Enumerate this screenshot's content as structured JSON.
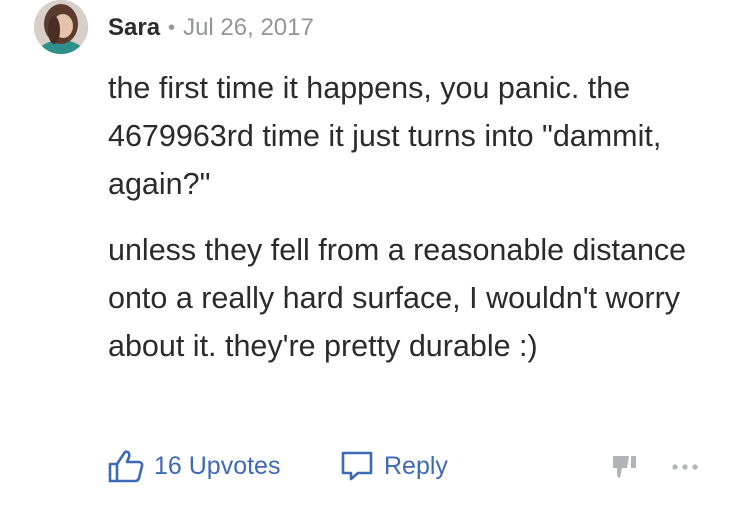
{
  "comment": {
    "author": "Sara",
    "separator": "•",
    "date": "Jul 26, 2017",
    "paragraphs": [
      "the first time it happens, you panic. the 4679963rd time it just turns into \"dammit, again?\"",
      "unless they fell from a reasonable distance onto a really hard surface, I wouldn't worry about it. they're pretty durable :)"
    ]
  },
  "actions": {
    "upvote_label": "16 Upvotes",
    "reply_label": "Reply",
    "upvote_icon": "thumbs-up-icon",
    "reply_icon": "speech-bubble-icon",
    "downvote_icon": "downvote-icon",
    "more_icon": "more-options-icon"
  },
  "colors": {
    "accent": "#3e69b5",
    "muted": "#939598",
    "text": "#2b2b2b",
    "icon_gray": "#b1b3b6"
  }
}
